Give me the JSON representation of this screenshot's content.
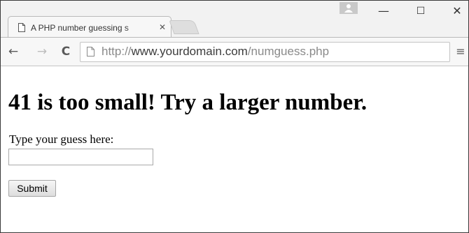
{
  "browser": {
    "tab": {
      "title": "A PHP number guessing s",
      "close_glyph": "✕",
      "icon": "page-icon"
    },
    "window_controls": {
      "minimize_glyph": "—",
      "maximize_glyph": "☐",
      "close_glyph": "✕"
    },
    "toolbar": {
      "back_glyph": "←",
      "forward_glyph": "→",
      "reload_glyph": "C",
      "menu_glyph": "≡",
      "url_scheme": "http://",
      "url_domain": "www.yourdomain.com",
      "url_path": "/numguess.php"
    },
    "colors": {
      "chrome_background": "#f2f2f2",
      "tab_background": "#f7f7f7",
      "page_background": "#ffffff"
    }
  },
  "page": {
    "heading": "41 is too small! Try a larger number.",
    "guess_label": "Type your guess here:",
    "guess_value": "",
    "submit_label": "Submit"
  }
}
